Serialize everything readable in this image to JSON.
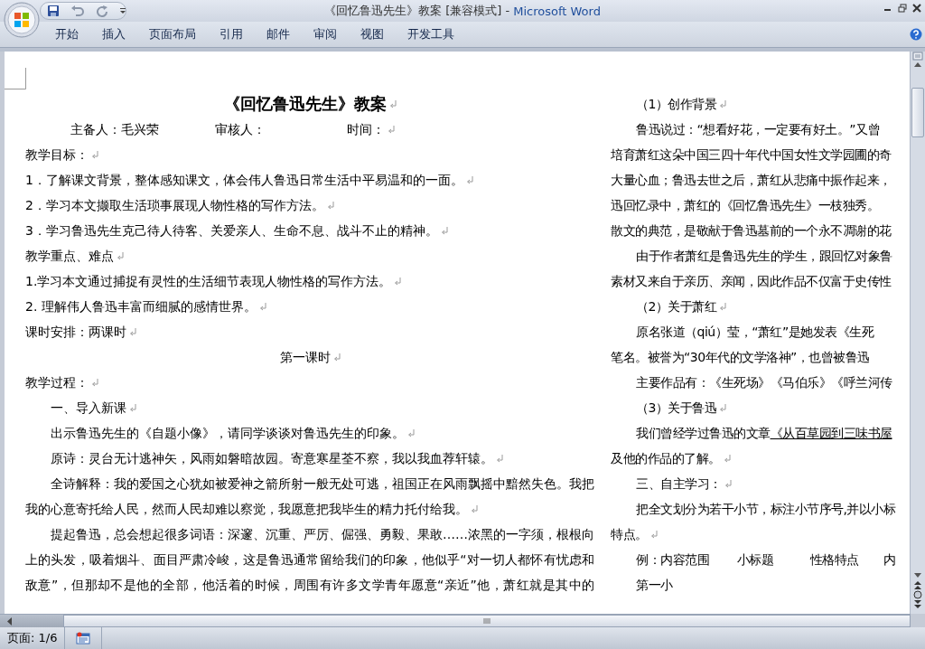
{
  "window": {
    "title": "《回忆鲁迅先生》教案 [兼容模式] -",
    "app_name": "Microsoft Word"
  },
  "ribbon_tabs": [
    {
      "label": "开始",
      "selected": false
    },
    {
      "label": "插入",
      "selected": false
    },
    {
      "label": "页面布局",
      "selected": false
    },
    {
      "label": "引用",
      "selected": false
    },
    {
      "label": "邮件",
      "selected": false
    },
    {
      "label": "审阅",
      "selected": false
    },
    {
      "label": "视图",
      "selected": false
    },
    {
      "label": "开发工具",
      "selected": false
    }
  ],
  "document": {
    "left_column": [
      {
        "kind": "title",
        "text": "《回忆鲁迅先生》教案",
        "end_mark": true
      },
      {
        "kind": "info",
        "items": [
          "主备人：毛兴荣",
          "审核人：",
          "时间："
        ],
        "end_mark": true
      },
      {
        "kind": "text",
        "text": "教学目标：",
        "indent": false,
        "end_mark": true
      },
      {
        "kind": "text",
        "text": "1．了解课文背景，整体感知课文，体会伟人鲁迅日常生活中平易温和的一面。",
        "indent": false,
        "end_mark": true
      },
      {
        "kind": "text",
        "text": "2．学习本文撷取生活琐事展现人物性格的写作方法。",
        "indent": false,
        "end_mark": true
      },
      {
        "kind": "text",
        "text": "3．学习鲁迅先生克己待人待客、关爱亲人、生命不息、战斗不止的精神。",
        "indent": false,
        "end_mark": true
      },
      {
        "kind": "text",
        "text": "教学重点、难点",
        "indent": false,
        "end_mark": true
      },
      {
        "kind": "text",
        "text": "1.学习本文通过捕捉有灵性的生活细节表现人物性格的写作方法。",
        "indent": false,
        "end_mark": true
      },
      {
        "kind": "text",
        "text": "2. 理解伟人鲁迅丰富而细腻的感情世界。",
        "indent": false,
        "end_mark": true
      },
      {
        "kind": "text",
        "text": "课时安排：两课时",
        "indent": false,
        "end_mark": true
      },
      {
        "kind": "center",
        "text": "第一课时",
        "end_mark": true
      },
      {
        "kind": "text",
        "text": "教学过程：",
        "indent": false,
        "end_mark": true
      },
      {
        "kind": "text",
        "text": "一、导入新课",
        "indent": true,
        "end_mark": true
      },
      {
        "kind": "text",
        "text": "出示鲁迅先生的《自题小像》，请同学谈谈对鲁迅先生的印象。",
        "indent": true,
        "end_mark": true
      },
      {
        "kind": "text",
        "text": "原诗：灵台无计逃神矢，风雨如磐暗故园。寄意寒星荃不察，我以我血荐轩辕。",
        "indent": true,
        "end_mark": true
      },
      {
        "kind": "text",
        "text": "全诗解释：我的爱国之心犹如被爱神之箭所射一般无处可逃，祖国正在风雨飘摇中黯然失色。我把",
        "indent": true,
        "justify": true,
        "end_mark": false
      },
      {
        "kind": "text",
        "text": "我的心意寄托给人民，然而人民却难以察觉，我愿意把我毕生的精力托付给我。",
        "indent": false,
        "end_mark": true
      },
      {
        "kind": "text",
        "text": "提起鲁迅，总会想起很多词语：深邃、沉重、严厉、倔强、勇毅、果敢……浓黑的一字须，根根向",
        "indent": true,
        "justify": true,
        "end_mark": false
      },
      {
        "kind": "text",
        "text": "上的头发，吸着烟斗、面目严肃冷峻，这是鲁迅通常留给我们的印象，他似乎“对一切人都怀有忧虑和",
        "indent": false,
        "justify": true,
        "end_mark": false
      },
      {
        "kind": "text",
        "text": "敌意”，但那却不是他的全部，他活着的时候，周围有许多文学青年愿意“亲近”他，萧红就是其中的",
        "indent": false,
        "justify": true,
        "end_mark": false
      }
    ],
    "right_column": [
      {
        "kind": "text",
        "text": "（1）创作背景",
        "indent": true,
        "end_mark": true
      },
      {
        "kind": "text",
        "text": "鲁迅说过：“想看好花，一定要有好土。”又曾",
        "indent": true,
        "end_mark": false
      },
      {
        "kind": "text",
        "text": "培育萧红这朵中国三四十年代中国女性文学园圃的奇",
        "indent": false,
        "end_mark": false
      },
      {
        "kind": "text",
        "text": "大量心血；鲁迅去世之后，萧红从悲痛中振作起来，",
        "indent": false,
        "end_mark": false
      },
      {
        "kind": "text",
        "text": "迅回忆录中，萧红的《回忆鲁迅先生》一枝独秀。",
        "indent": false,
        "end_mark": false
      },
      {
        "kind": "text",
        "text": "散文的典范，是敬献于鲁迅墓前的一个永不凋谢的花",
        "indent": false,
        "end_mark": false
      },
      {
        "kind": "text",
        "text": "由于作者萧红是鲁迅先生的学生，跟回忆对象鲁",
        "indent": true,
        "end_mark": false
      },
      {
        "kind": "text",
        "text": "素材又来自于亲历、亲闻，因此作品不仅富于史传性",
        "indent": false,
        "end_mark": false
      },
      {
        "kind": "text",
        "text": "（2）关于萧红",
        "indent": true,
        "end_mark": true
      },
      {
        "kind": "text",
        "text": "原名张道（qiú）莹，“萧红”是她发表《生死",
        "indent": true,
        "end_mark": false
      },
      {
        "kind": "text",
        "text": "笔名。被誉为“30年代的文学洛神”，也曾被鲁迅",
        "indent": false,
        "end_mark": false
      },
      {
        "kind": "text",
        "text": "主要作品有：《生死场》《马伯乐》《呼兰河传",
        "indent": true,
        "end_mark": false
      },
      {
        "kind": "text",
        "text": "（3）关于鲁迅",
        "indent": true,
        "end_mark": true
      },
      {
        "kind": "text",
        "text": "我们曾经学过鲁迅的文章",
        "underlined": "《从百草园到三味书屋",
        "indent": true,
        "end_mark": false
      },
      {
        "kind": "text",
        "text": "及他的作品的了解。",
        "indent": false,
        "end_mark": true
      },
      {
        "kind": "text",
        "text": "三、自主学习：",
        "indent": true,
        "end_mark": true
      },
      {
        "kind": "text",
        "text": "把全文划分为若干小节，标注小节序号,并以小标",
        "indent": true,
        "end_mark": false
      },
      {
        "kind": "text",
        "text": "特点。",
        "indent": false,
        "end_mark": true
      },
      {
        "kind": "text",
        "text": "例：内容范围　　 小标题　　　性格特点　　内",
        "indent": true,
        "end_mark": false
      },
      {
        "kind": "text",
        "text": "第一小",
        "indent": true,
        "end_mark": false
      }
    ]
  },
  "status_bar": {
    "page": "页面: 1/6"
  }
}
